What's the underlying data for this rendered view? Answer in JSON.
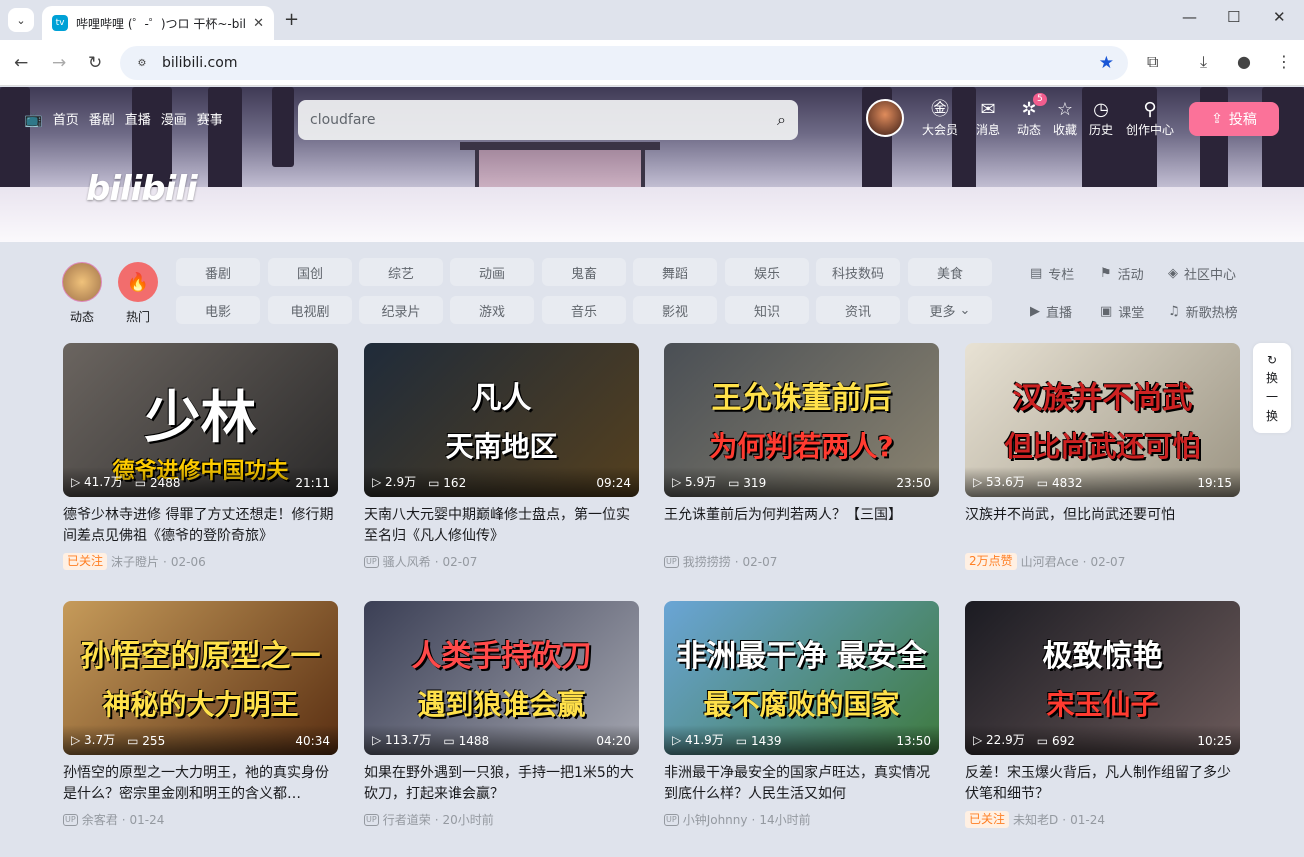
{
  "browser": {
    "tab_title": "哔哩哔哩 (゜-゜)つロ 干杯~-bili",
    "url": "bilibili.com"
  },
  "header": {
    "nav": [
      "首页",
      "番剧",
      "直播",
      "漫画",
      "赛事"
    ],
    "logo": "bilibili",
    "search_value": "cloudfare",
    "right_items": [
      {
        "label": "大会员",
        "icon": "vip-icon"
      },
      {
        "label": "消息",
        "icon": "message-icon"
      },
      {
        "label": "动态",
        "icon": "dynamic-icon",
        "badge": "5"
      },
      {
        "label": "收藏",
        "icon": "star-icon"
      },
      {
        "label": "历史",
        "icon": "history-icon"
      },
      {
        "label": "创作中心",
        "icon": "creator-icon"
      }
    ],
    "upload_label": "投稿"
  },
  "channels": {
    "big": [
      {
        "label": "动态",
        "icon": "avatar-icon"
      },
      {
        "label": "热门",
        "icon": "fire-icon"
      }
    ],
    "row1": [
      "番剧",
      "国创",
      "综艺",
      "动画",
      "鬼畜",
      "舞蹈",
      "娱乐",
      "科技数码",
      "美食"
    ],
    "row2": [
      "电影",
      "电视剧",
      "纪录片",
      "游戏",
      "音乐",
      "影视",
      "知识",
      "资讯",
      "更多"
    ],
    "side": [
      {
        "label": "专栏",
        "icon": "column-icon"
      },
      {
        "label": "活动",
        "icon": "activity-icon"
      },
      {
        "label": "社区中心",
        "icon": "community-icon"
      },
      {
        "label": "直播",
        "icon": "live-icon"
      },
      {
        "label": "课堂",
        "icon": "class-icon"
      },
      {
        "label": "新歌热榜",
        "icon": "music-chart-icon"
      }
    ]
  },
  "refresh_label": [
    "换",
    "一",
    "换"
  ],
  "videos": [
    {
      "overlay_top": "少林",
      "overlay_bottom": "德爷进修中国功夫",
      "views": "41.7万",
      "danmaku": "2488",
      "duration": "21:11",
      "title": "德爷少林寺进修 得罪了方丈还想走！修行期间差点见佛祖《德爷的登阶奇旅》",
      "tag": "已关注",
      "author": "沫子瞪片",
      "date": "02-06"
    },
    {
      "overlay_top": "凡人",
      "overlay_bottom": "天南地区",
      "views": "2.9万",
      "danmaku": "162",
      "duration": "09:24",
      "title": "天南八大元婴中期巅峰修士盘点，第一位实至名归《凡人修仙传》",
      "tag": "",
      "author": "骚人风希",
      "date": "02-07"
    },
    {
      "overlay_top": "王允诛董前后",
      "overlay_bottom": "为何判若两人?",
      "views": "5.9万",
      "danmaku": "319",
      "duration": "23:50",
      "title": "王允诛董前后为何判若两人？【三国】",
      "tag": "",
      "author": "我捞捞捞",
      "date": "02-07"
    },
    {
      "overlay_top": "汉族并不尚武",
      "overlay_bottom": "但比尚武还可怕",
      "views": "53.6万",
      "danmaku": "4832",
      "duration": "19:15",
      "title": "汉族并不尚武，但比尚武还要可怕",
      "tag": "2万点赞",
      "author": "山河君Ace",
      "date": "02-07"
    },
    {
      "overlay_top": "孙悟空的原型之一",
      "overlay_bottom": "神秘的大力明王",
      "views": "3.7万",
      "danmaku": "255",
      "duration": "40:34",
      "title": "孙悟空的原型之一大力明王，祂的真实身份是什么？密宗里金刚和明王的含义都…",
      "tag": "",
      "author": "余客君",
      "date": "01-24"
    },
    {
      "overlay_top": "人类手持砍刀",
      "overlay_bottom": "遇到狼谁会赢",
      "views": "113.7万",
      "danmaku": "1488",
      "duration": "04:20",
      "title": "如果在野外遇到一只狼，手持一把1米5的大砍刀，打起来谁会赢？",
      "tag": "",
      "author": "行者道荣",
      "date": "20小时前"
    },
    {
      "overlay_top": "非洲最干净  最安全",
      "overlay_bottom": "最不腐败的国家",
      "views": "41.9万",
      "danmaku": "1439",
      "duration": "13:50",
      "title": "非洲最干净最安全的国家卢旺达，真实情况到底什么样？人民生活又如何",
      "tag": "",
      "author": "小钟Johnny",
      "date": "14小时前"
    },
    {
      "overlay_top": "极致惊艳",
      "overlay_bottom": "宋玉仙子",
      "views": "22.9万",
      "danmaku": "692",
      "duration": "10:25",
      "title": "反差！宋玉爆火背后，凡人制作组留了多少伏笔和细节？",
      "tag": "已关注",
      "author": "未知老D",
      "date": "01-24"
    }
  ]
}
